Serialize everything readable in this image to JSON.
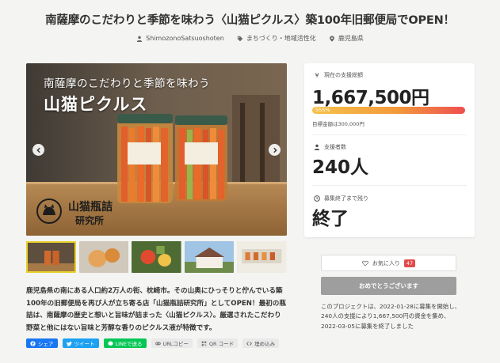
{
  "page": {
    "title": "南薩摩のこだわりと季節を味わう〈山猫ピクルス〉築100年旧郵便局でOPEN！"
  },
  "meta": {
    "author": "ShimozonoSatsuoshoten",
    "category": "まちづくり・地域活性化",
    "location": "鹿児島県"
  },
  "hero": {
    "line1": "南薩摩のこだわりと季節を味わう",
    "line2": "山猫ピクルス",
    "logo_line1": "山猫瓶詰",
    "logo_line2": "研究所"
  },
  "description": "鹿児島県の南にある人口約2万人の街、枕崎市。その山奥にひっそりと佇んでいる築100年の旧郵便局を再び人が立ち寄る店「山猫瓶詰研究所」としてOPEN！最初の瓶詰は、南薩摩の歴史と想いと旨味が詰まった〈山猫ピクルス〉。厳選されたこだわり野菜と他にはない旨味と芳醇な香りのピクルス液が特徴です。",
  "share": {
    "facebook": "シェア",
    "twitter": "ツイート",
    "line": "LINEで送る",
    "url_copy": "URLコピー",
    "qr": "QR コード",
    "embed": "埋め込み"
  },
  "funding": {
    "total_label": "現在の支援総額",
    "total_amount": "1,667,500円",
    "progress_text": "555%",
    "progress_percent": 555,
    "goal_text": "目標金額は300,000円",
    "supporters_label": "支援者数",
    "supporters_value": "240人",
    "remaining_label": "募集終了まで残り",
    "remaining_value": "終了"
  },
  "actions": {
    "favorite_label": "お気に入り",
    "favorite_count": "47",
    "congrats_label": "おめでとうございます"
  },
  "closing_note": "このプロジェクトは、2022-01-28に募集を開始し、240人の支援により1,667,500円の資金を集め、2022-03-05に募集を終了しました",
  "colors": {
    "progress_start": "#f6c24a",
    "progress_end": "#ee4f4f",
    "favorite_badge": "#e24a4a",
    "facebook": "#1877f2",
    "twitter": "#1da1f2",
    "line": "#06c755"
  }
}
